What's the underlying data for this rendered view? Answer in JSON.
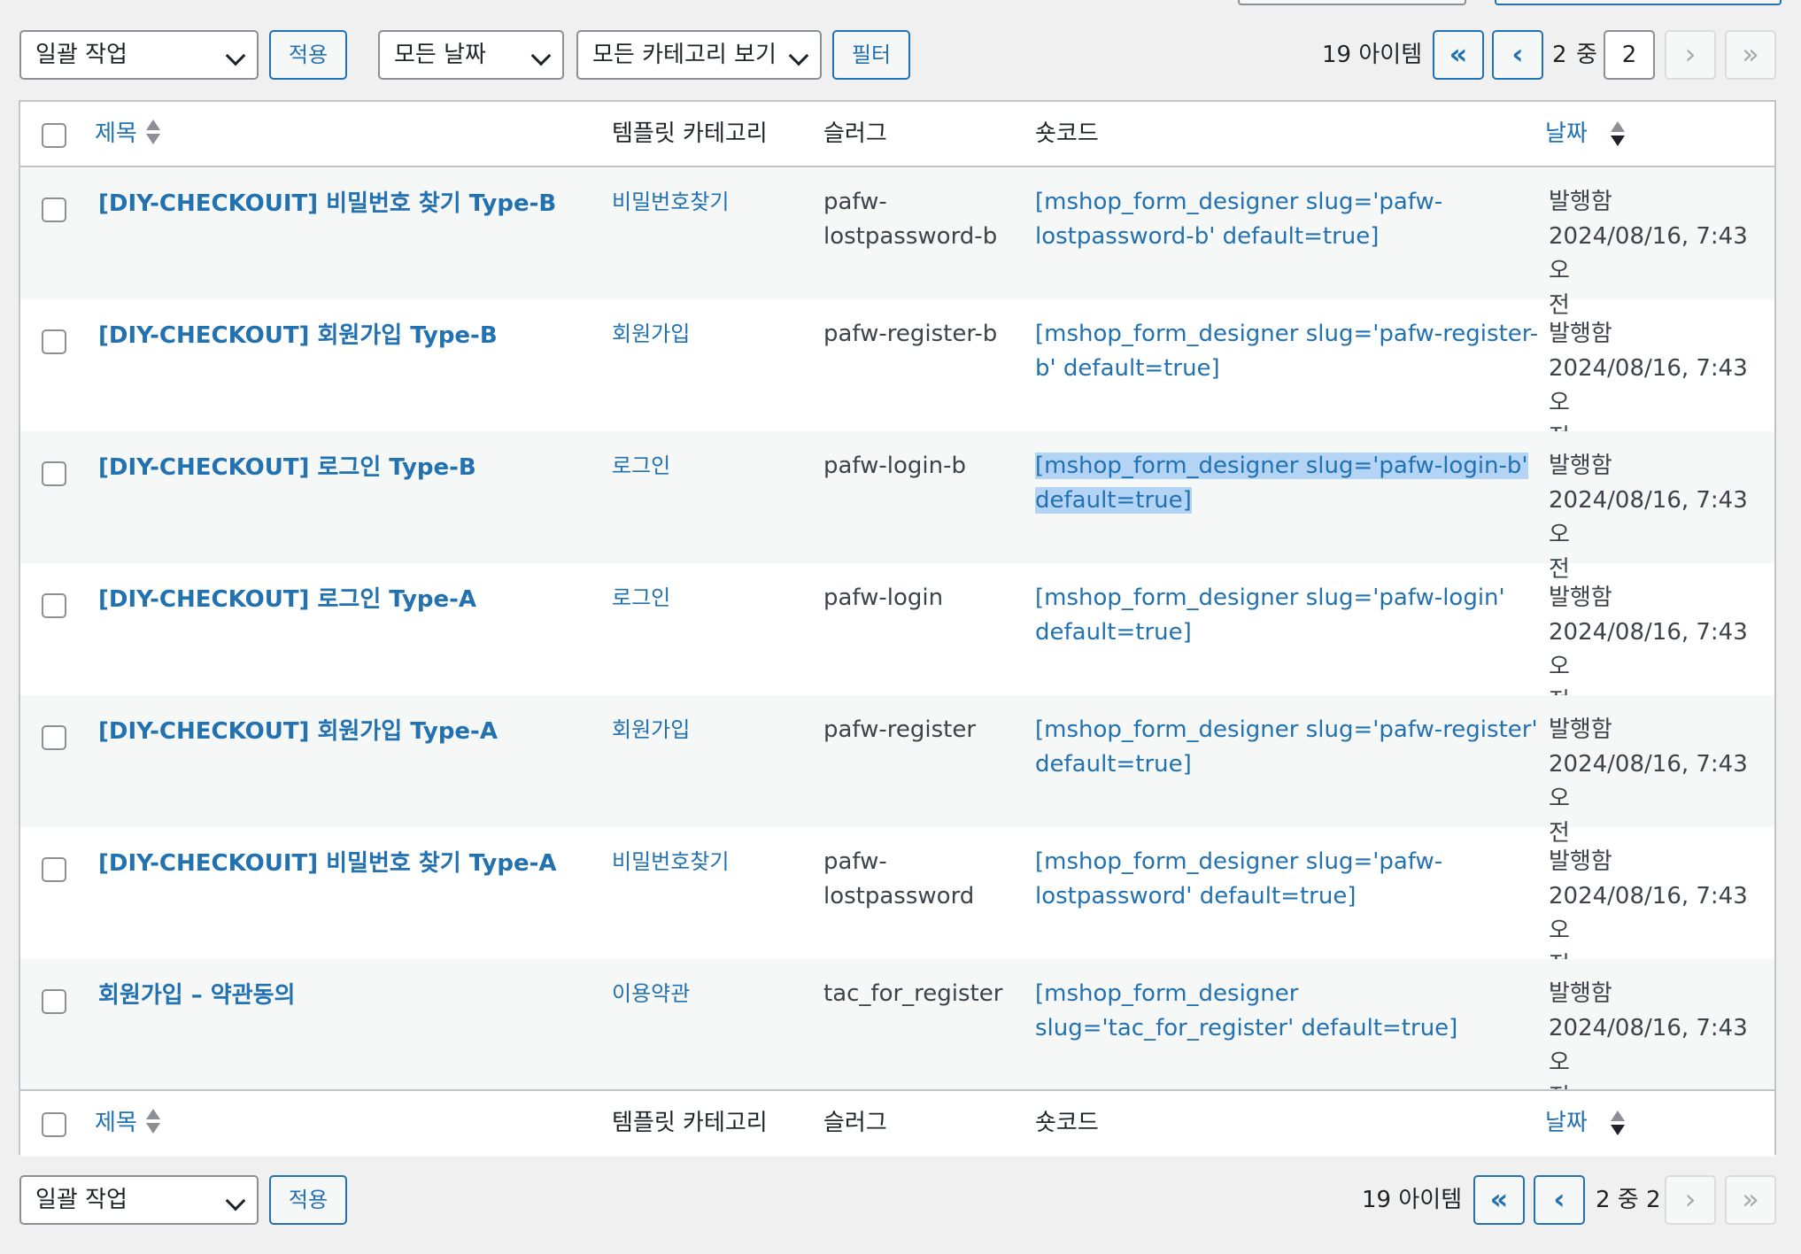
{
  "top_nav": {
    "bulk_action": "일괄 작업",
    "apply": "적용",
    "date_filter": "모든 날짜",
    "category_filter": "모든 카테고리 보기",
    "filter": "필터",
    "item_count": "19 아이템",
    "first": "«",
    "prev": "‹",
    "current_page": "2",
    "of_label": "중",
    "page_input": "2",
    "next": "›",
    "last": "»"
  },
  "columns": {
    "title": "제목",
    "category": "템플릿 카테고리",
    "slug": "슬러그",
    "shortcode": "숏코드",
    "date": "날짜"
  },
  "rows": [
    {
      "title": "[DIY-CHECKOUIT] 비밀번호 찾기 Type-B",
      "category": "비밀번호찾기",
      "slug": [
        "pafw-",
        "lostpassword-b"
      ],
      "shortcode": [
        "[mshop_form_designer slug='pafw-",
        "lostpassword-b' default=true]"
      ],
      "status": "발행함",
      "date": [
        "2024/08/16, 7:43 오",
        "전"
      ]
    },
    {
      "title": "[DIY-CHECKOUT] 회원가입 Type-B",
      "category": "회원가입",
      "slug": [
        "pafw-register-b"
      ],
      "shortcode": [
        "[mshop_form_designer slug='pafw-register-",
        "b' default=true]"
      ],
      "status": "발행함",
      "date": [
        "2024/08/16, 7:43 오",
        "전"
      ]
    },
    {
      "title": "[DIY-CHECKOUT] 로그인 Type-B",
      "category": "로그인",
      "slug": [
        "pafw-login-b"
      ],
      "shortcode": [
        "[mshop_form_designer slug='pafw-login-b'",
        "default=true]"
      ],
      "status": "발행함",
      "date": [
        "2024/08/16, 7:43 오",
        "전"
      ]
    },
    {
      "title": "[DIY-CHECKOUT] 로그인 Type-A",
      "category": "로그인",
      "slug": [
        "pafw-login"
      ],
      "shortcode": [
        "[mshop_form_designer slug='pafw-login'",
        "default=true]"
      ],
      "status": "발행함",
      "date": [
        "2024/08/16, 7:43 오",
        "전"
      ]
    },
    {
      "title": "[DIY-CHECKOUT] 회원가입 Type-A",
      "category": "회원가입",
      "slug": [
        "pafw-register"
      ],
      "shortcode": [
        "[mshop_form_designer slug='pafw-register'",
        "default=true]"
      ],
      "status": "발행함",
      "date": [
        "2024/08/16, 7:43 오",
        "전"
      ]
    },
    {
      "title": "[DIY-CHECKOUIT] 비밀번호 찾기 Type-A",
      "category": "비밀번호찾기",
      "slug": [
        "pafw-",
        "lostpassword"
      ],
      "shortcode": [
        "[mshop_form_designer slug='pafw-",
        "lostpassword' default=true]"
      ],
      "status": "발행함",
      "date": [
        "2024/08/16, 7:43 오",
        "전"
      ]
    },
    {
      "title": "회원가입 – 약관동의",
      "category": "이용약관",
      "slug": [
        "tac_for_register"
      ],
      "shortcode": [
        "[mshop_form_designer",
        "slug='tac_for_register' default=true]"
      ],
      "status": "발행함",
      "date": [
        "2024/08/16, 7:43 오",
        "전"
      ]
    }
  ],
  "bottom_nav": {
    "bulk_action": "일괄 작업",
    "apply": "적용",
    "item_count": "19 아이템",
    "first": "«",
    "prev": "‹",
    "page_text": "2 중 2",
    "next": "›",
    "last": "»"
  },
  "colors": {
    "link": "#2271b1",
    "highlight": "#b4d4f6",
    "row_alt": "#f6f7f7"
  }
}
